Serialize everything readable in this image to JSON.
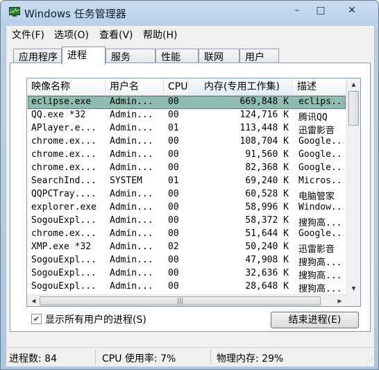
{
  "window": {
    "title": "Windows 任务管理器"
  },
  "menu": [
    "文件(F)",
    "选项(O)",
    "查看(V)",
    "帮助(H)"
  ],
  "tabs": [
    "应用程序",
    "进程",
    "服务",
    "性能",
    "联网",
    "用户"
  ],
  "active_tab": "进程",
  "columns": [
    "映像名称",
    "用户名",
    "CPU",
    "内存(专用工作集)",
    "描述"
  ],
  "processes": [
    {
      "name": "eclipse.exe",
      "user": "Admin...",
      "cpu": "00",
      "mem": "669,848 K",
      "desc": "eclips..."
    },
    {
      "name": "QQ.exe *32",
      "user": "Admin...",
      "cpu": "00",
      "mem": "124,716 K",
      "desc": "腾讯QQ"
    },
    {
      "name": "APlayer.e...",
      "user": "Admin...",
      "cpu": "01",
      "mem": "113,448 K",
      "desc": "迅雷影音"
    },
    {
      "name": "chrome.ex...",
      "user": "Admin...",
      "cpu": "00",
      "mem": "108,704 K",
      "desc": "Google..."
    },
    {
      "name": "chrome.ex...",
      "user": "Admin...",
      "cpu": "00",
      "mem": "91,560 K",
      "desc": "Google..."
    },
    {
      "name": "chrome.ex...",
      "user": "Admin...",
      "cpu": "00",
      "mem": "82,368 K",
      "desc": "Google..."
    },
    {
      "name": "SearchInd...",
      "user": "SYSTEM",
      "cpu": "01",
      "mem": "69,240 K",
      "desc": "Micros..."
    },
    {
      "name": "QQPCTray....",
      "user": "Admin...",
      "cpu": "00",
      "mem": "60,528 K",
      "desc": "电脑管家"
    },
    {
      "name": "explorer.exe",
      "user": "Admin...",
      "cpu": "00",
      "mem": "58,996 K",
      "desc": "Window..."
    },
    {
      "name": "SogouExpl...",
      "user": "Admin...",
      "cpu": "00",
      "mem": "58,372 K",
      "desc": "搜狗高..."
    },
    {
      "name": "chrome.ex...",
      "user": "Admin...",
      "cpu": "00",
      "mem": "51,644 K",
      "desc": "Google..."
    },
    {
      "name": "XMP.exe *32",
      "user": "Admin...",
      "cpu": "02",
      "mem": "50,240 K",
      "desc": "迅雷影音"
    },
    {
      "name": "SogouExpl...",
      "user": "Admin...",
      "cpu": "00",
      "mem": "47,908 K",
      "desc": "搜狗高..."
    },
    {
      "name": "SogouExpl...",
      "user": "Admin...",
      "cpu": "00",
      "mem": "32,636 K",
      "desc": "搜狗高..."
    },
    {
      "name": "SogouExpl...",
      "user": "Admin...",
      "cpu": "00",
      "mem": "28,648 K",
      "desc": "搜狗高..."
    }
  ],
  "show_all_users": {
    "label": "显示所有用户的进程(S)",
    "checked": true
  },
  "end_process_label": "结束进程(E)",
  "status": {
    "processes": "进程数: 84",
    "cpu": "CPU 使用率: 7%",
    "memory": "物理内存: 29%"
  },
  "icons": [
    "task-manager-icon",
    "minimize-icon",
    "maximize-icon",
    "close-icon"
  ],
  "colors": {
    "selection": "#8fbcb1",
    "title_bg": "#b9d0e8"
  }
}
